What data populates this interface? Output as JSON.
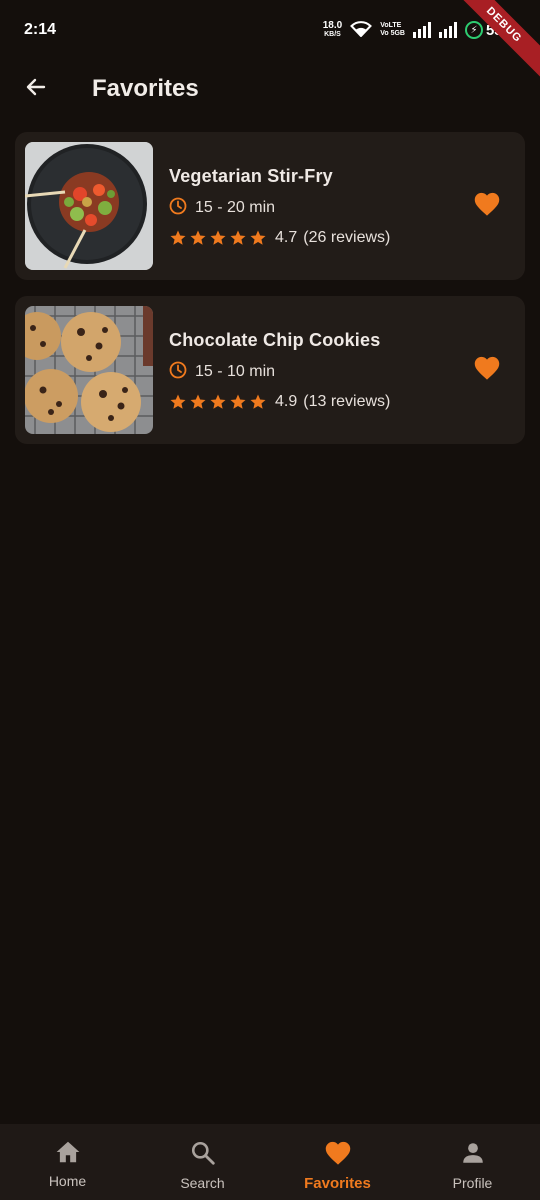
{
  "status_bar": {
    "time": "2:14",
    "net_speed": "18.0",
    "net_unit": "KB/S",
    "volte_1": "VoLTE",
    "volte_2": "Vo 5GB",
    "battery": "53%",
    "debug_label": "DEBUG"
  },
  "app_bar": {
    "title": "Favorites",
    "back_icon": "arrow-left-icon"
  },
  "favorites": [
    {
      "title": "Vegetarian Stir-Fry",
      "time": "15 - 20 min",
      "stars": 5,
      "rating": "4.7",
      "reviews": "(26 reviews)",
      "favorited": true
    },
    {
      "title": "Chocolate Chip Cookies",
      "time": "15 - 10 min",
      "stars": 5,
      "rating": "4.9",
      "reviews": "(13 reviews)",
      "favorited": true
    }
  ],
  "bottom_nav": {
    "items": [
      {
        "label": "Home",
        "icon": "home-icon"
      },
      {
        "label": "Search",
        "icon": "search-icon"
      },
      {
        "label": "Favorites",
        "icon": "heart-icon"
      },
      {
        "label": "Profile",
        "icon": "person-icon"
      }
    ],
    "active_index": 2
  },
  "colors": {
    "accent": "#f07a1e",
    "background": "#140f0c",
    "card": "#221c18"
  }
}
